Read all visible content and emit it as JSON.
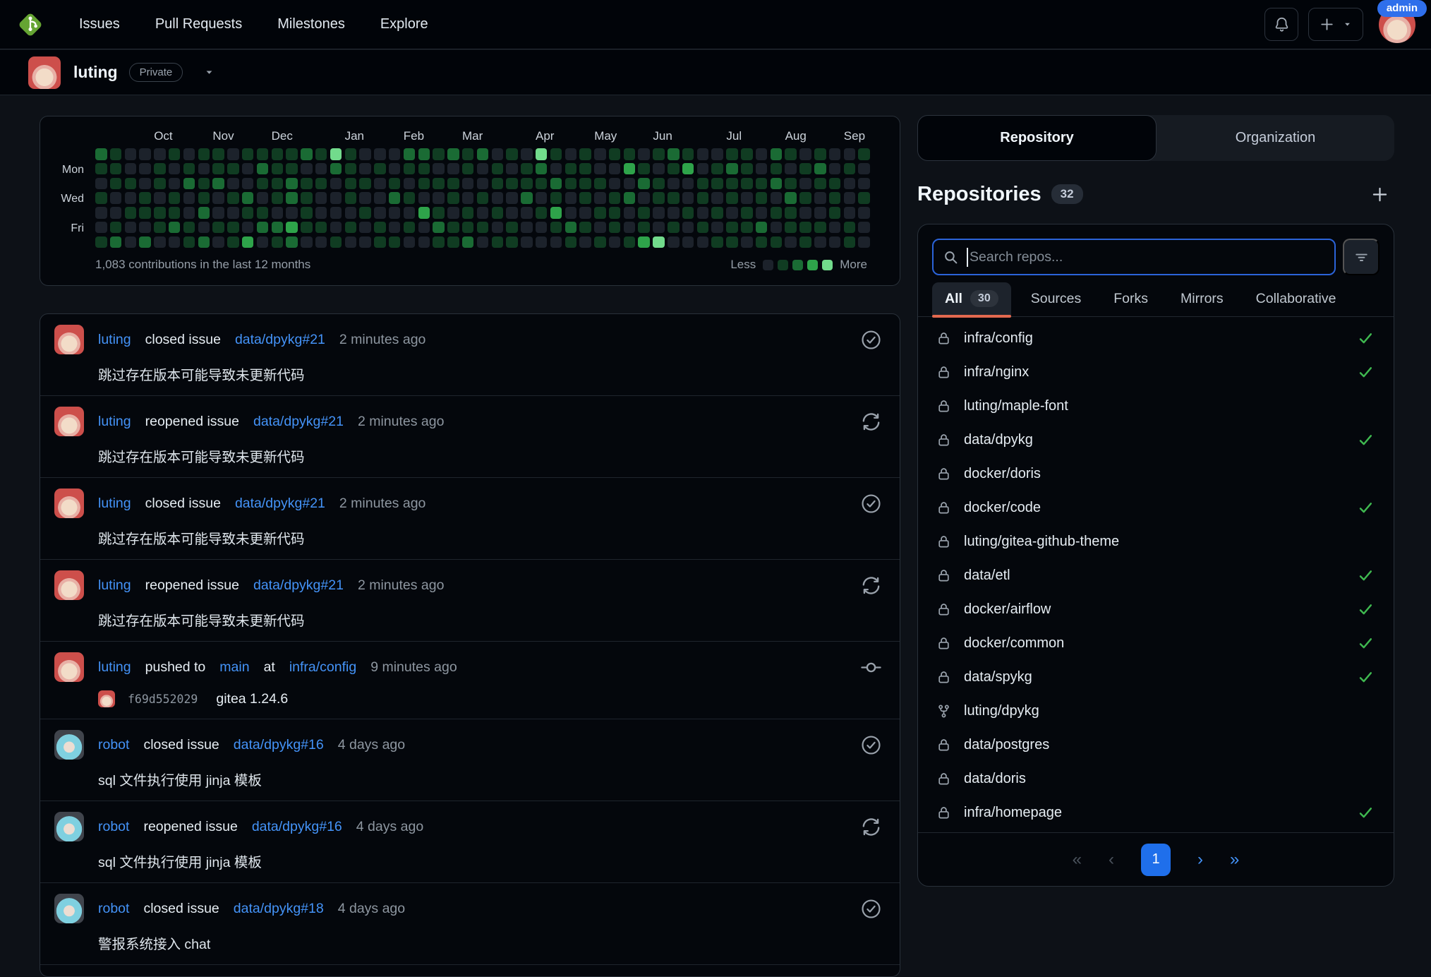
{
  "navbar": {
    "links": [
      "Issues",
      "Pull Requests",
      "Milestones",
      "Explore"
    ],
    "admin_badge": "admin",
    "accent_blue": "#2f6feb"
  },
  "profile": {
    "username": "luting",
    "visibility_badge": "Private"
  },
  "chart_data": {
    "type": "heatmap",
    "title": "1,083 contributions in the last 12 months",
    "legend": {
      "less": "Less",
      "more": "More"
    },
    "months": [
      {
        "label": "Oct",
        "col": 4
      },
      {
        "label": "Nov",
        "col": 8
      },
      {
        "label": "Dec",
        "col": 12
      },
      {
        "label": "Jan",
        "col": 17
      },
      {
        "label": "Feb",
        "col": 21
      },
      {
        "label": "Mar",
        "col": 25
      },
      {
        "label": "Apr",
        "col": 30
      },
      {
        "label": "May",
        "col": 34
      },
      {
        "label": "Jun",
        "col": 38
      },
      {
        "label": "Jul",
        "col": 43
      },
      {
        "label": "Aug",
        "col": 47
      },
      {
        "label": "Sep",
        "col": 51
      }
    ],
    "day_labels": [
      {
        "label": "Mon",
        "row": 1
      },
      {
        "label": "Wed",
        "row": 3
      },
      {
        "label": "Fri",
        "row": 5
      }
    ],
    "level_colors": [
      "#1c222b",
      "#103c22",
      "#1a6b34",
      "#2ea34a",
      "#72db8c"
    ],
    "weeks": [
      "2101001",
      "1110012",
      "0010100",
      "0001102",
      "0110110",
      "1001120",
      "0120011",
      "1011202",
      "1120010",
      "0101011",
      "1002103",
      "1210120",
      "1111021",
      "1122032",
      "2011110",
      "1010010",
      "4200001",
      "1111010",
      "0010100",
      "0100011",
      "0012001",
      "2101010",
      "2110300",
      "1010121",
      "2011011",
      "1100112",
      "2001010",
      "0110101",
      "1010011",
      "0112000",
      "4210100",
      "1021310",
      "0110021",
      "1111010",
      "0010101",
      "1001110",
      "1302001",
      "0120113",
      "1011004",
      "2101010",
      "1300100",
      "0011010",
      "0110101",
      "1211011",
      "1110110",
      "0011021",
      "2120101",
      "1012110",
      "0101011",
      "1210010",
      "0011100",
      "0100011",
      "1001000"
    ]
  },
  "feed": {
    "items": [
      {
        "type": "issue",
        "avatar": "luting",
        "user": "luting",
        "action": "closed issue",
        "repo_link": "data/dpykg#21",
        "time": "2 minutes ago",
        "body": "跳过存在版本可能导致未更新代码",
        "icon": "issue-closed"
      },
      {
        "type": "issue",
        "avatar": "luting",
        "user": "luting",
        "action": "reopened issue",
        "repo_link": "data/dpykg#21",
        "time": "2 minutes ago",
        "body": "跳过存在版本可能导致未更新代码",
        "icon": "issue-reopened"
      },
      {
        "type": "issue",
        "avatar": "luting",
        "user": "luting",
        "action": "closed issue",
        "repo_link": "data/dpykg#21",
        "time": "2 minutes ago",
        "body": "跳过存在版本可能导致未更新代码",
        "icon": "issue-closed"
      },
      {
        "type": "issue",
        "avatar": "luting",
        "user": "luting",
        "action": "reopened issue",
        "repo_link": "data/dpykg#21",
        "time": "2 minutes ago",
        "body": "跳过存在版本可能导致未更新代码",
        "icon": "issue-reopened"
      },
      {
        "type": "push",
        "avatar": "luting",
        "user": "luting",
        "action": "pushed to",
        "branch": "main",
        "connector": "at",
        "repo_link": "infra/config",
        "time": "9 minutes ago",
        "commit_hash": "f69d552029",
        "commit_message": "gitea 1.24.6",
        "icon": "commit"
      },
      {
        "type": "issue",
        "avatar": "robot",
        "user": "robot",
        "action": "closed issue",
        "repo_link": "data/dpykg#16",
        "time": "4 days ago",
        "body": "sql 文件执行使用 jinja 模板",
        "icon": "issue-closed"
      },
      {
        "type": "issue",
        "avatar": "robot",
        "user": "robot",
        "action": "reopened issue",
        "repo_link": "data/dpykg#16",
        "time": "4 days ago",
        "body": "sql 文件执行使用 jinja 模板",
        "icon": "issue-reopened"
      },
      {
        "type": "issue",
        "avatar": "robot",
        "user": "robot",
        "action": "closed issue",
        "repo_link": "data/dpykg#18",
        "time": "4 days ago",
        "body": "警报系统接入 chat",
        "icon": "issue-closed"
      }
    ]
  },
  "sidebar": {
    "tabs": [
      {
        "label": "Repository",
        "active": true
      },
      {
        "label": "Organization",
        "active": false
      }
    ],
    "heading": {
      "title": "Repositories",
      "count": "32"
    },
    "search": {
      "placeholder": "Search repos..."
    },
    "filters": [
      {
        "label": "All",
        "count": "30",
        "active": true
      },
      {
        "label": "Sources"
      },
      {
        "label": "Forks"
      },
      {
        "label": "Mirrors"
      },
      {
        "label": "Collaborative"
      }
    ],
    "repos": [
      {
        "name": "infra/config",
        "icon": "lock",
        "synced": true
      },
      {
        "name": "infra/nginx",
        "icon": "lock",
        "synced": true
      },
      {
        "name": "luting/maple-font",
        "icon": "lock",
        "synced": false
      },
      {
        "name": "data/dpykg",
        "icon": "lock",
        "synced": true
      },
      {
        "name": "docker/doris",
        "icon": "lock",
        "synced": false
      },
      {
        "name": "docker/code",
        "icon": "lock",
        "synced": true
      },
      {
        "name": "luting/gitea-github-theme",
        "icon": "lock",
        "synced": false
      },
      {
        "name": "data/etl",
        "icon": "lock",
        "synced": true
      },
      {
        "name": "docker/airflow",
        "icon": "lock",
        "synced": true
      },
      {
        "name": "docker/common",
        "icon": "lock",
        "synced": true
      },
      {
        "name": "data/spykg",
        "icon": "lock",
        "synced": true
      },
      {
        "name": "luting/dpykg",
        "icon": "fork",
        "synced": false
      },
      {
        "name": "data/postgres",
        "icon": "lock",
        "synced": false
      },
      {
        "name": "data/doris",
        "icon": "lock",
        "synced": false
      },
      {
        "name": "infra/homepage",
        "icon": "lock",
        "synced": true
      }
    ],
    "pagination": {
      "first": "«",
      "prev": "‹",
      "current": "1",
      "next": "›",
      "last": "»"
    }
  }
}
